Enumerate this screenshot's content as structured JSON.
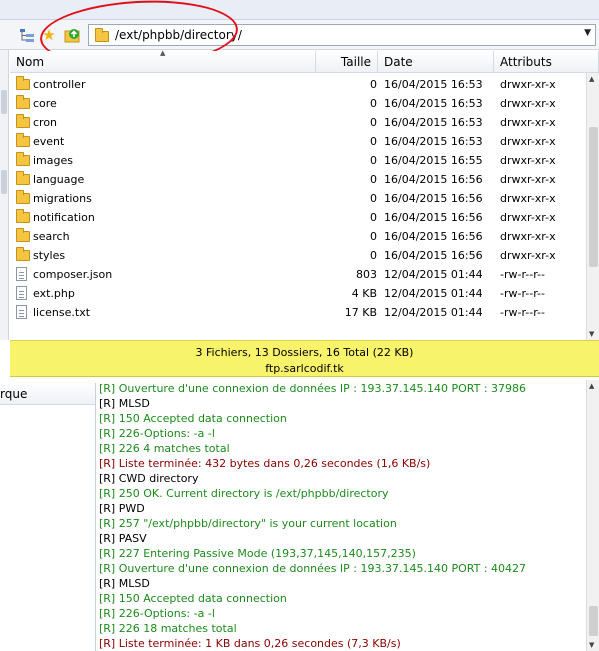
{
  "toolbar": {
    "icons": [
      "tree-view-icon",
      "bookmark-star-icon",
      "parent-folder-icon"
    ],
    "path": "/ext/phpbb/directory/"
  },
  "file_list": {
    "columns": {
      "name": "Nom",
      "size": "Taille",
      "date": "Date",
      "attributes": "Attributs"
    },
    "rows": [
      {
        "type": "folder",
        "name": "controller",
        "size": "0",
        "date": "16/04/2015 16:53",
        "attributes": "drwxr-xr-x"
      },
      {
        "type": "folder",
        "name": "core",
        "size": "0",
        "date": "16/04/2015 16:53",
        "attributes": "drwxr-xr-x"
      },
      {
        "type": "folder",
        "name": "cron",
        "size": "0",
        "date": "16/04/2015 16:53",
        "attributes": "drwxr-xr-x"
      },
      {
        "type": "folder",
        "name": "event",
        "size": "0",
        "date": "16/04/2015 16:53",
        "attributes": "drwxr-xr-x"
      },
      {
        "type": "folder",
        "name": "images",
        "size": "0",
        "date": "16/04/2015 16:55",
        "attributes": "drwxr-xr-x"
      },
      {
        "type": "folder",
        "name": "language",
        "size": "0",
        "date": "16/04/2015 16:56",
        "attributes": "drwxr-xr-x"
      },
      {
        "type": "folder",
        "name": "migrations",
        "size": "0",
        "date": "16/04/2015 16:56",
        "attributes": "drwxr-xr-x"
      },
      {
        "type": "folder",
        "name": "notification",
        "size": "0",
        "date": "16/04/2015 16:56",
        "attributes": "drwxr-xr-x"
      },
      {
        "type": "folder",
        "name": "search",
        "size": "0",
        "date": "16/04/2015 16:56",
        "attributes": "drwxr-xr-x"
      },
      {
        "type": "folder",
        "name": "styles",
        "size": "0",
        "date": "16/04/2015 16:56",
        "attributes": "drwxr-xr-x"
      },
      {
        "type": "file",
        "name": "composer.json",
        "size": "803",
        "date": "12/04/2015 01:44",
        "attributes": "-rw-r--r--"
      },
      {
        "type": "file",
        "name": "ext.php",
        "size": "4 KB",
        "date": "12/04/2015 01:44",
        "attributes": "-rw-r--r--"
      },
      {
        "type": "file",
        "name": "license.txt",
        "size": "17 KB",
        "date": "12/04/2015 01:44",
        "attributes": "-rw-r--r--"
      }
    ]
  },
  "status": {
    "summary": "3 Fichiers, 13 Dossiers, 16 Total (22 KB)",
    "host": "ftp.sarlcodif.tk"
  },
  "bottom_left": {
    "header": "rque"
  },
  "log": [
    {
      "color": "green",
      "text": "[R] Ouverture d'une connexion de données IP : 193.37.145.140 PORT : 37986"
    },
    {
      "color": "black",
      "text": "[R] MLSD"
    },
    {
      "color": "green",
      "text": "[R] 150 Accepted data connection"
    },
    {
      "color": "green",
      "text": "[R] 226-Options: -a -l"
    },
    {
      "color": "green",
      "text": "[R] 226 4 matches total"
    },
    {
      "color": "red",
      "text": "[R] Liste terminée: 432 bytes dans 0,26 secondes (1,6 KB/s)"
    },
    {
      "color": "black",
      "text": "[R] CWD directory"
    },
    {
      "color": "green",
      "text": "[R] 250 OK. Current directory is /ext/phpbb/directory"
    },
    {
      "color": "black",
      "text": "[R] PWD"
    },
    {
      "color": "green",
      "text": "[R] 257 \"/ext/phpbb/directory\" is your current location"
    },
    {
      "color": "black",
      "text": "[R] PASV"
    },
    {
      "color": "green",
      "text": "[R] 227 Entering Passive Mode (193,37,145,140,157,235)"
    },
    {
      "color": "green",
      "text": "[R] Ouverture d'une connexion de données IP : 193.37.145.140 PORT : 40427"
    },
    {
      "color": "black",
      "text": "[R] MLSD"
    },
    {
      "color": "green",
      "text": "[R] 150 Accepted data connection"
    },
    {
      "color": "green",
      "text": "[R] 226-Options: -a -l"
    },
    {
      "color": "green",
      "text": "[R] 226 18 matches total"
    },
    {
      "color": "red",
      "text": "[R] Liste terminée: 1 KB dans 0,26 secondes (7,3 KB/s)"
    }
  ]
}
